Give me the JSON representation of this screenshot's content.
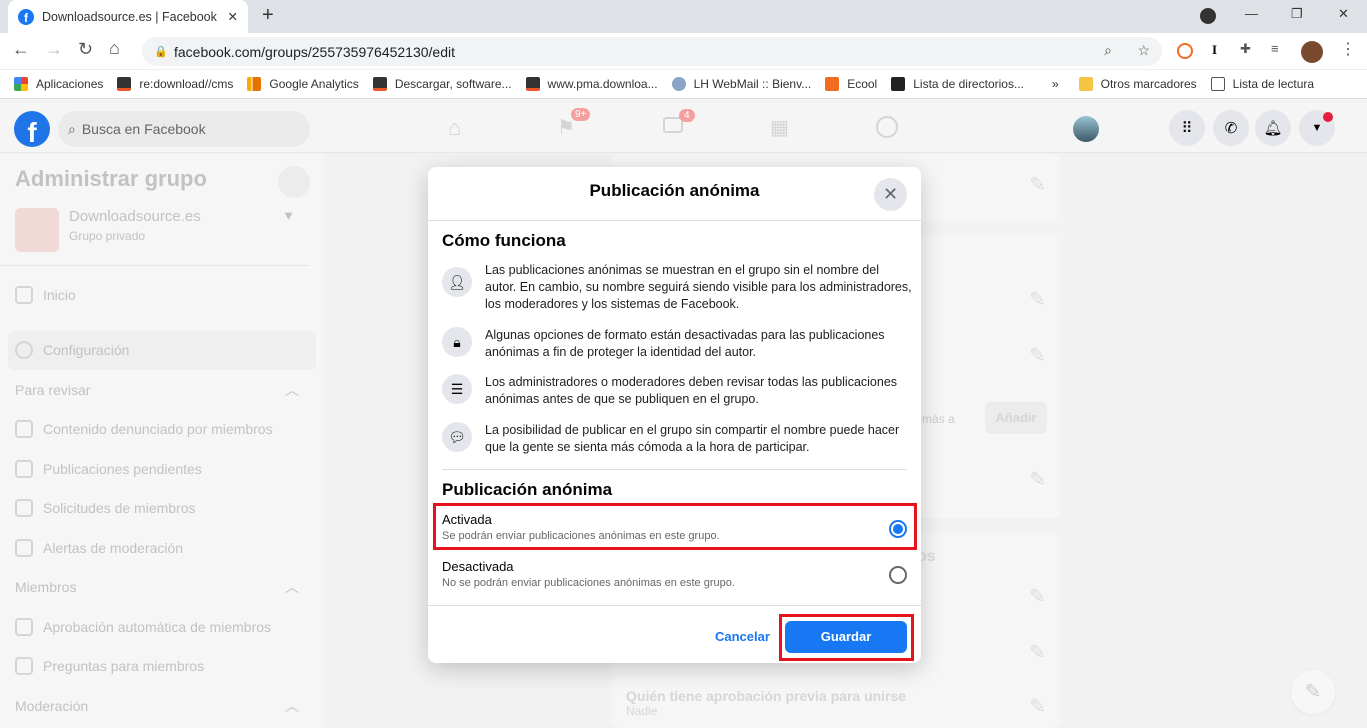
{
  "browser": {
    "tab_title": "Downloadsource.es | Facebook",
    "url": "facebook.com/groups/255735976452130/edit",
    "bookmarks": [
      "Aplicaciones",
      "re:download//cms",
      "Google Analytics",
      "Descargar, software...",
      "www.pma.downloa...",
      "LH WebMail :: Bienv...",
      "Ecool",
      "Lista de directorios..."
    ],
    "other_bookmarks": "Otros marcadores",
    "reading_list": "Lista de lectura"
  },
  "fb_header": {
    "search_placeholder": "Busca en Facebook",
    "badge_groups": "9+",
    "badge_watch": "4"
  },
  "sidebar": {
    "title": "Administrar grupo",
    "group_name": "Downloadsource.es",
    "privacy": "Grupo privado",
    "items": {
      "home": "Inicio",
      "settings": "Configuración"
    },
    "sections": [
      {
        "label": "Para revisar",
        "items": [
          "Contenido denunciado por miembros",
          "Publicaciones pendientes",
          "Solicitudes de miembros",
          "Alertas de moderación"
        ]
      },
      {
        "label": "Miembros",
        "items": [
          "Aprobación automática de miembros",
          "Preguntas para miembros"
        ]
      },
      {
        "label": "Moderación",
        "items": []
      }
    ]
  },
  "background": {
    "snippet": "más a",
    "add_button": "Añadir",
    "heading_fragment": "os",
    "row_title": "Quién tiene aprobación previa para unirse",
    "row_value": "Nadie"
  },
  "modal": {
    "title": "Publicación anónima",
    "how_title": "Cómo funciona",
    "info": [
      "Las publicaciones anónimas se muestran en el grupo sin el nombre del autor. En cambio, su nombre seguirá siendo visible para los administradores, los moderadores y los sistemas de Facebook.",
      "Algunas opciones de formato están desactivadas para las publicaciones anónimas a fin de proteger la identidad del autor.",
      "Los administradores o moderadores deben revisar todas las publicaciones anónimas antes de que se publiquen en el grupo.",
      "La posibilidad de publicar en el grupo sin compartir el nombre puede hacer que la gente se sienta más cómoda a la hora de participar."
    ],
    "section_title": "Publicación anónima",
    "options": [
      {
        "label": "Activada",
        "desc": "Se podrán enviar publicaciones anónimas en este grupo.",
        "selected": true
      },
      {
        "label": "Desactivada",
        "desc": "No se podrán enviar publicaciones anónimas en este grupo.",
        "selected": false
      }
    ],
    "cancel": "Cancelar",
    "save": "Guardar"
  },
  "colors": {
    "accent": "#1877f2",
    "highlight": "#e4131d"
  }
}
